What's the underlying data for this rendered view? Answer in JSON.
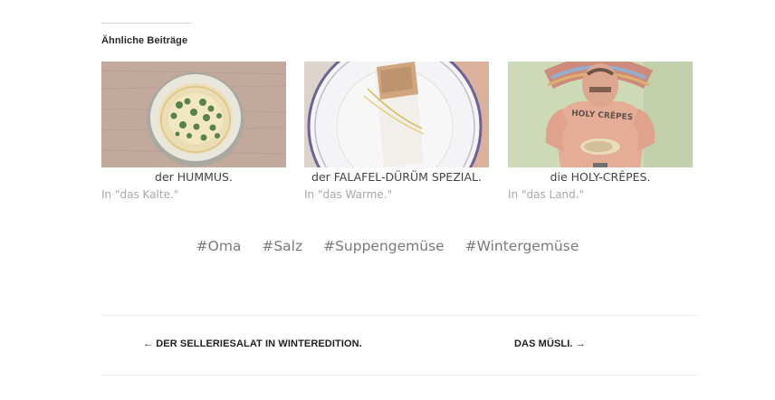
{
  "related": {
    "heading": "Ähnliche Beiträge",
    "items": [
      {
        "title": "der HUMMUS.",
        "category": "In \"das Kalte.\"",
        "image": "hummus-bowl-photo"
      },
      {
        "title": "der FALAFEL-DÜRÜM SPEZIAL.",
        "category": "In \"das Warme.\"",
        "image": "falafel-wrap-plate-photo"
      },
      {
        "title": "die HOLY-CRÊPES.",
        "category": "In \"das Land.\"",
        "image": "holy-crepes-man-photo",
        "photo_text": "HOLY CRÊPES"
      }
    ]
  },
  "tags": [
    "#Oma",
    "#Salz",
    "#Suppengemüse",
    "#Wintergemüse"
  ],
  "post_nav": {
    "prev": "← DER SELLERIESALAT IN WINTEREDITION.",
    "next": "DAS MÜSLI. →"
  },
  "colors": {
    "heading_text": "#2a2a2a",
    "meta_text": "#a8a8a8",
    "tag_text": "#7a7a7a"
  }
}
